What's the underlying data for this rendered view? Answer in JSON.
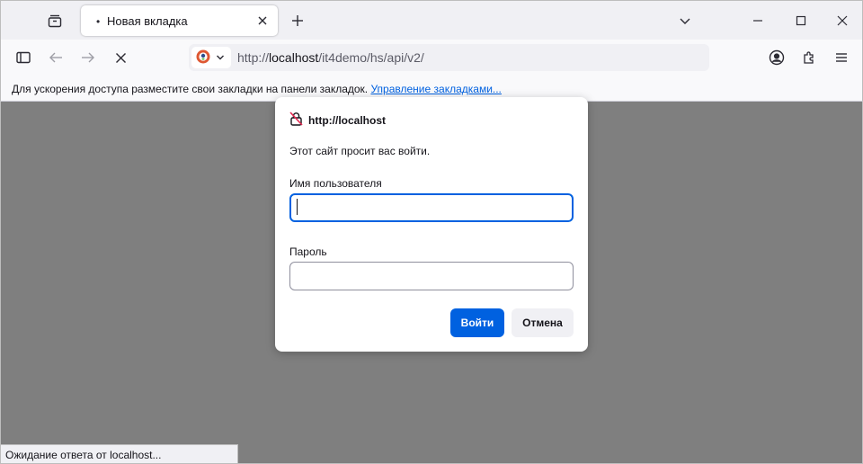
{
  "tabbar": {
    "tab": {
      "title": "Новая вкладка",
      "dot": "•"
    },
    "new_tab_symbol": "+"
  },
  "navbar": {
    "url_prefix": "http://",
    "url_host": "localhost",
    "url_path": "/it4demo/hs/api/v2/"
  },
  "bookmarks": {
    "hint": "Для ускорения доступа разместите свои закладки на панели закладок. ",
    "manage_link": "Управление закладками..."
  },
  "dialog": {
    "origin": "http://localhost",
    "message": "Этот сайт просит вас войти.",
    "username_label": "Имя пользователя",
    "username_value": "",
    "password_label": "Пароль",
    "password_value": "",
    "ok_label": "Войти",
    "cancel_label": "Отмена"
  },
  "status": {
    "text": "Ожидание ответа от localhost..."
  },
  "colors": {
    "accent": "#0061e0",
    "overlay": "#7f7f7f",
    "chrome": "#f0f0f4"
  },
  "icons": [
    "tab-list-icon",
    "close-icon",
    "plus-icon",
    "chevron-down-icon",
    "minimize-icon",
    "maximize-icon",
    "window-close-icon",
    "sidebar-icon",
    "back-arrow-icon",
    "forward-arrow-icon",
    "stop-icon",
    "duckduckgo-icon",
    "account-icon",
    "extensions-icon",
    "menu-icon",
    "lock-slash-icon"
  ]
}
